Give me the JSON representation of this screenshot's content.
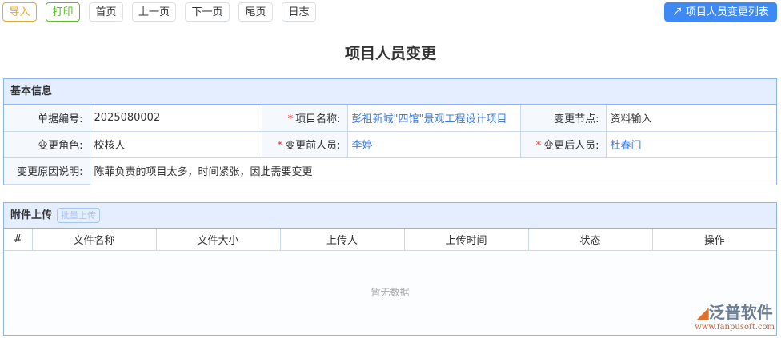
{
  "toolbar": {
    "import": "导入",
    "print": "打印",
    "first": "首页",
    "prev": "上一页",
    "next": "下一页",
    "last": "尾页",
    "log": "日志",
    "list": "项目人员变更列表"
  },
  "title": "项目人员变更",
  "basic": {
    "header": "基本信息",
    "doc_no_label": "单据编号:",
    "doc_no": "2025080002",
    "project_label": "项目名称:",
    "project": "彭祖新城\"四馆\"景观工程设计项目",
    "node_label": "变更节点:",
    "node": "资料输入",
    "role_label": "变更角色:",
    "role": "校核人",
    "before_label": "变更前人员:",
    "before": "李婷",
    "after_label": "变更后人员:",
    "after": "杜春门",
    "reason_label": "变更原因说明:",
    "reason": "陈菲负责的项目太多，时间紧张，因此需要变更"
  },
  "attach": {
    "header": "附件上传",
    "batch": "批量上传",
    "columns": [
      "#",
      "文件名称",
      "文件大小",
      "上传人",
      "上传时间",
      "状态",
      "操作"
    ],
    "empty": "暂无数据"
  },
  "logo": {
    "name": "泛普软件",
    "url": "www.fanpusoft.com"
  }
}
